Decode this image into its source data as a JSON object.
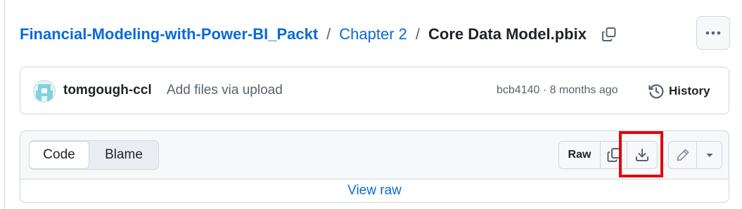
{
  "breadcrumb": {
    "repo": "Financial-Modeling-with-Power-BI_Packt",
    "separator": "/",
    "folder": "Chapter 2",
    "file": "Core Data Model.pbix"
  },
  "commit": {
    "author": "tomgough-ccl",
    "message": "Add files via upload",
    "meta": "bcb4140 · 8 months ago",
    "history_label": "History"
  },
  "file_header": {
    "tabs": [
      "Code",
      "Blame"
    ],
    "raw_label": "Raw"
  },
  "view_raw": "View raw",
  "colors": {
    "link": "#0969da",
    "highlight": "#e0060b",
    "border": "#d0d7de",
    "panel": "#f6f8fa"
  },
  "icons": [
    "copy-icon",
    "kebab-icon",
    "history-icon",
    "download-icon",
    "pencil-icon",
    "triangle-down-icon"
  ]
}
